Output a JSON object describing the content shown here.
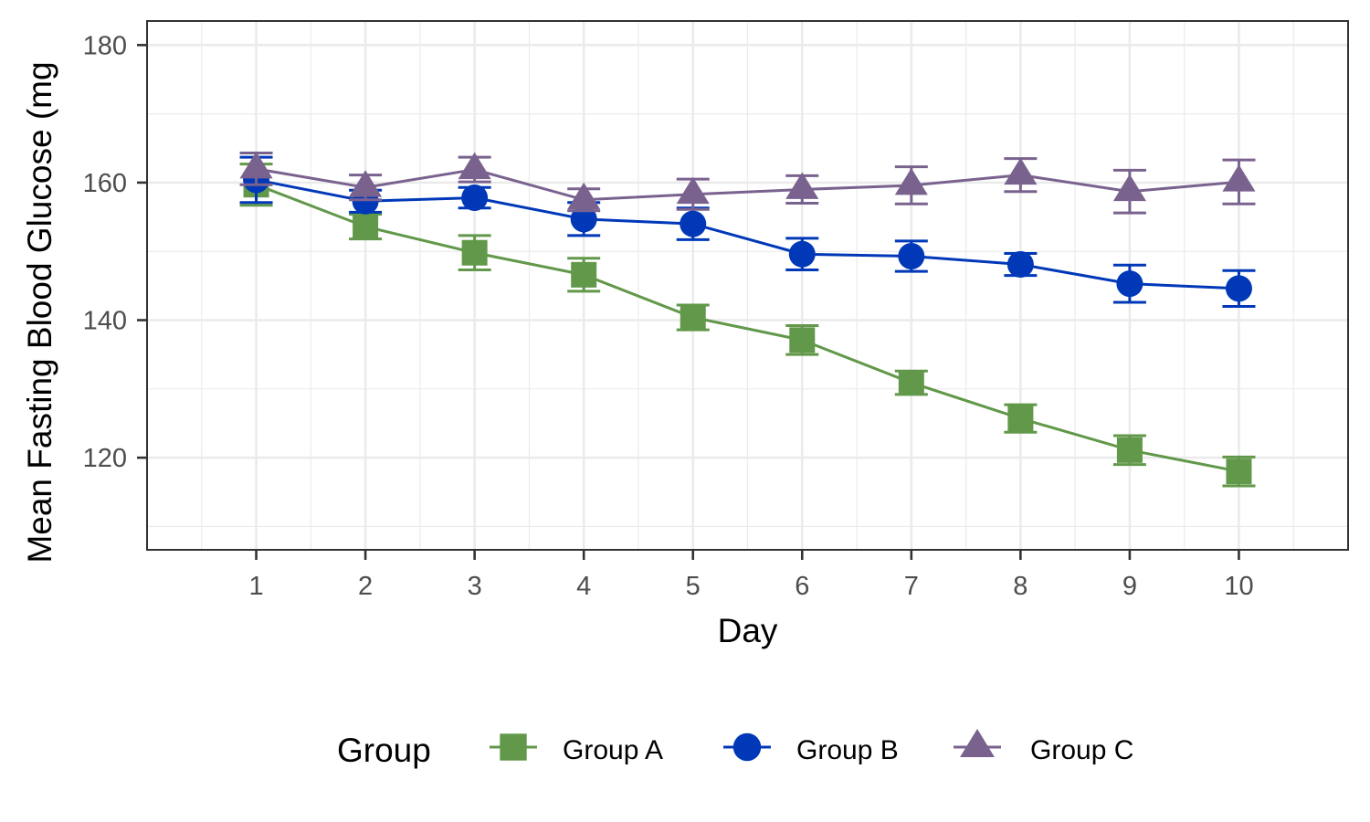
{
  "chart_data": {
    "type": "line",
    "title": "",
    "xlabel": "Day",
    "ylabel": "Mean Fasting Blood Glucose (mg",
    "x": [
      1,
      2,
      3,
      4,
      5,
      6,
      7,
      8,
      9,
      10
    ],
    "x_tick_labels": [
      "1",
      "2",
      "3",
      "4",
      "5",
      "6",
      "7",
      "8",
      "9",
      "10"
    ],
    "y_ticks": [
      120,
      140,
      160,
      180
    ],
    "y_tick_labels": [
      "120",
      "140",
      "160",
      "180"
    ],
    "xlim": [
      0,
      11
    ],
    "ylim": [
      106.6,
      183.5
    ],
    "grid": true,
    "error_bars": true,
    "legend": {
      "title": "Group",
      "position": "bottom",
      "entries": [
        "Group A",
        "Group B",
        "Group C"
      ]
    },
    "series": [
      {
        "name": "Group A",
        "marker": "square",
        "color": "#62984a",
        "values": [
          159.7,
          153.6,
          149.8,
          146.6,
          140.4,
          137.1,
          130.9,
          125.7,
          121.1,
          118.0
        ],
        "error": [
          3.0,
          1.8,
          2.5,
          2.4,
          1.8,
          2.1,
          1.7,
          2.0,
          2.1,
          2.1
        ]
      },
      {
        "name": "Group B",
        "marker": "circle",
        "color": "#0038b8",
        "values": [
          160.4,
          157.3,
          157.8,
          154.7,
          154.0,
          149.6,
          149.3,
          148.1,
          145.3,
          144.6
        ],
        "error": [
          3.3,
          1.6,
          1.5,
          2.4,
          2.3,
          2.3,
          2.2,
          1.6,
          2.7,
          2.6
        ]
      },
      {
        "name": "Group C",
        "marker": "triangle",
        "color": "#7a628f",
        "values": [
          162.0,
          159.3,
          161.9,
          157.5,
          158.3,
          159.0,
          159.6,
          161.1,
          158.7,
          160.1
        ],
        "error": [
          2.3,
          1.8,
          1.8,
          1.6,
          2.2,
          2.0,
          2.7,
          2.4,
          3.1,
          3.2
        ]
      }
    ]
  }
}
